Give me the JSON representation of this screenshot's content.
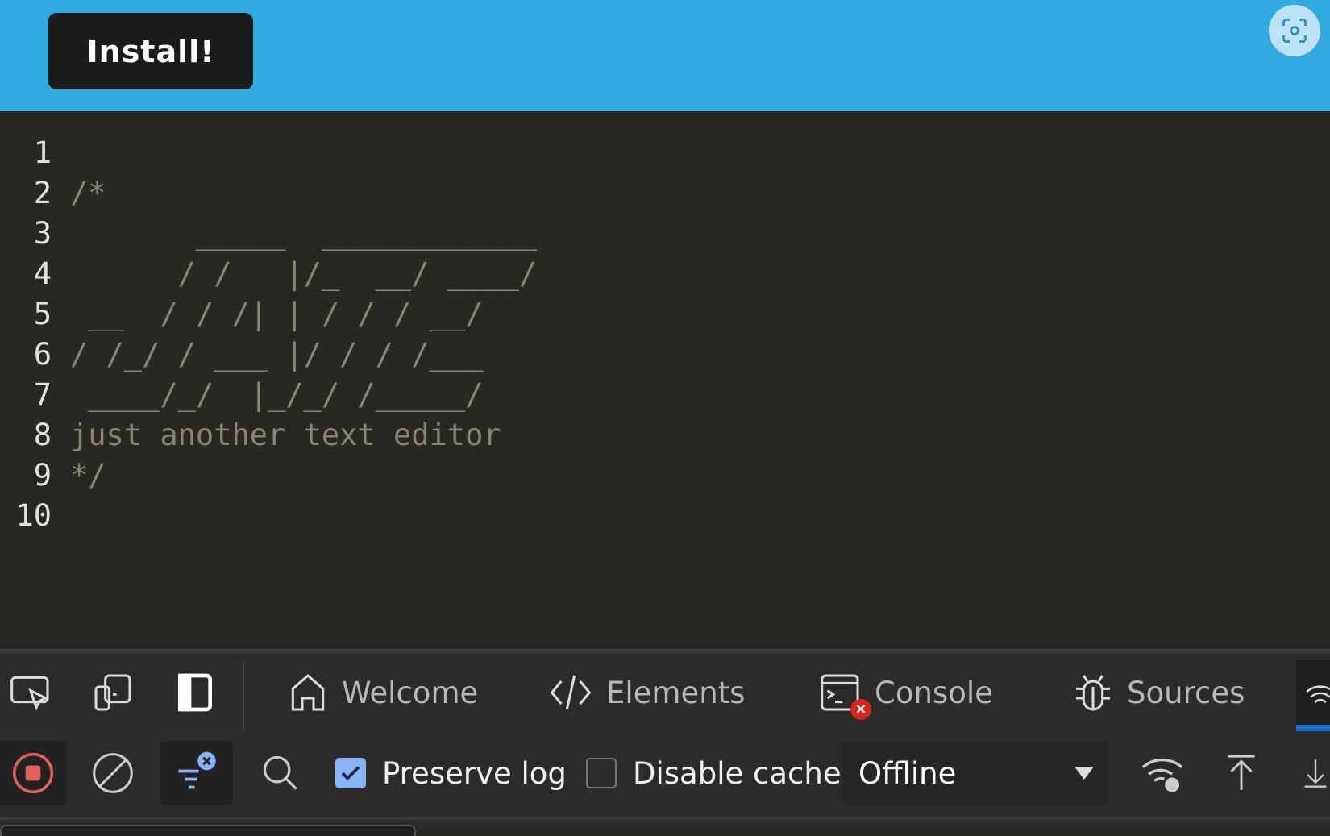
{
  "app": {
    "install_label": "Install!"
  },
  "editor": {
    "lines": [
      {
        "n": "1",
        "text": ""
      },
      {
        "n": "2",
        "text": "/*"
      },
      {
        "n": "3",
        "text": "       _____  ____________"
      },
      {
        "n": "4",
        "text": "      / /   |/_  __/ ____/"
      },
      {
        "n": "5",
        "text": " __  / / /| | / / / __/"
      },
      {
        "n": "6",
        "text": "/ /_/ / ___ |/ / / /___"
      },
      {
        "n": "7",
        "text": " ____/_/  |_/_/ /_____/"
      },
      {
        "n": "8",
        "text": "just another text editor"
      },
      {
        "n": "9",
        "text": "*/"
      },
      {
        "n": "10",
        "text": ""
      }
    ]
  },
  "devtools": {
    "tabs": [
      {
        "label": "Welcome",
        "icon": "home-icon"
      },
      {
        "label": "Elements",
        "icon": "code-icon"
      },
      {
        "label": "Console",
        "icon": "console-icon"
      },
      {
        "label": "Sources",
        "icon": "bug-icon"
      }
    ],
    "toolbar": {
      "preserve_log": "Preserve log",
      "preserve_log_checked": true,
      "disable_cache": "Disable cache",
      "disable_cache_checked": false,
      "throttle": "Offline"
    }
  },
  "colors": {
    "topbar": "#31a9e1",
    "editor_bg": "#282823",
    "comment": "#8a8471",
    "accent": "#1a73c9",
    "record": "#e0625a"
  }
}
